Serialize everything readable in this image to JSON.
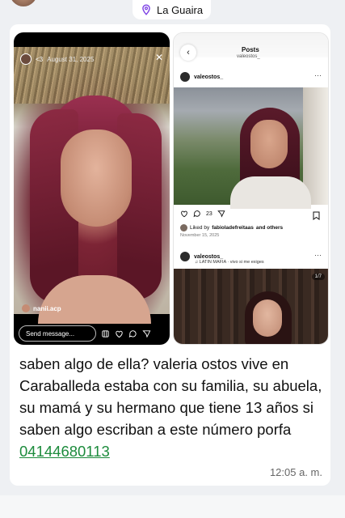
{
  "header": {
    "location": "La Guaira"
  },
  "story": {
    "username": "<3",
    "date": "August 31, 2025",
    "tagged_user": "nanii.acp",
    "send_placeholder": "Send message..."
  },
  "posts_view": {
    "title": "Posts",
    "subtitle": "valeostos_",
    "post1": {
      "username": "valeostos_",
      "comments": "23",
      "liked_by_prefix": "Liked by",
      "liked_by_user": "fabioladefreitaas",
      "liked_by_suffix": "and others",
      "date": "November 15, 2025"
    },
    "post2": {
      "username": "valeostos_",
      "music": "LATIN MAFIA · vivo si me exiges",
      "carousel_counter": "1/7"
    }
  },
  "message": {
    "text": "saben algo de ella? valeria ostos vive en Caraballeda estaba con su familia, su abuela, su mamá y su hermano que tiene 13 años si saben algo escriban a este número porfa ",
    "phone": "04144680113",
    "time": "12:05 a. m."
  },
  "colors": {
    "link_green": "#1c8b3c",
    "background": "#eef0f3"
  },
  "icons": [
    "location-pin-icon",
    "chevron-left-icon",
    "more-icon",
    "heart-icon",
    "comment-icon",
    "share-icon",
    "bookmark-icon",
    "music-icon",
    "close-icon"
  ]
}
